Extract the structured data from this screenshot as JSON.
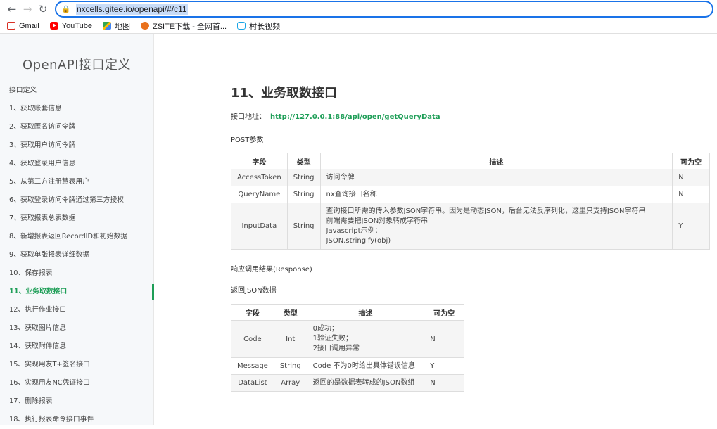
{
  "browser": {
    "url_host": "nxcells.gitee.io",
    "url_path": "/openapi/#/c11",
    "bookmarks": [
      "Gmail",
      "YouTube",
      "地图",
      "ZSITE下载 - 全网首...",
      "村长视频"
    ]
  },
  "sidebar": {
    "title": "OpenAPI接口定义",
    "items": [
      "接口定义",
      "1、获取账套信息",
      "2、获取匿名访问令牌",
      "3、获取用户访问令牌",
      "4、获取登录用户信息",
      "5、从第三方注册慧表用户",
      "6、获取登录访问令牌通过第三方授权",
      "7、获取报表总表数据",
      "8、新增报表返回RecordID和初始数据",
      "9、获取单张报表详细数据",
      "10、保存报表",
      "11、业务取数接口",
      "12、执行作业接口",
      "13、获取图片信息",
      "14、获取附件信息",
      "15、实现用友T+签名接口",
      "16、实现用友NC凭证接口",
      "17、删除报表",
      "18、执行报表命令接口事件"
    ],
    "active_index": 11
  },
  "main": {
    "title": "11、业务取数接口",
    "endpoint_label": "接口地址：",
    "endpoint_url": "http://127.0.0.1:88/api/open/getQueryData",
    "post_params_label": "POST参数",
    "params_table": {
      "headers": [
        "字段",
        "类型",
        "描述",
        "可为空"
      ],
      "rows": [
        {
          "field": "AccessToken",
          "type": "String",
          "desc": [
            "访问令牌"
          ],
          "nullable": "N"
        },
        {
          "field": "QueryName",
          "type": "String",
          "desc": [
            "nx查询接口名称"
          ],
          "nullable": "N"
        },
        {
          "field": "InputData",
          "type": "String",
          "desc": [
            "查询接口所需的传入参数JSON字符串。因为是动态JSON，后台无法反序列化，这里只支持JSON字符串",
            "前端需要把JSON对象转成字符串",
            "Javascript示例：",
            "JSON.stringify(obj)"
          ],
          "nullable": "Y"
        }
      ]
    },
    "response_label": "响应调用结果(Response)",
    "return_label": "返回JSON数据",
    "return_table": {
      "headers": [
        "字段",
        "类型",
        "描述",
        "可为空"
      ],
      "rows": [
        {
          "field": "Code",
          "type": "Int",
          "desc": [
            "0成功；",
            "1验证失败；",
            "2接口调用异常"
          ],
          "nullable": "N"
        },
        {
          "field": "Message",
          "type": "String",
          "desc": [
            "Code 不为0时给出具体错误信息"
          ],
          "nullable": "Y"
        },
        {
          "field": "DataList",
          "type": "Array",
          "desc": [
            "返回的是数据表转成的JSON数组"
          ],
          "nullable": "N"
        }
      ]
    }
  }
}
